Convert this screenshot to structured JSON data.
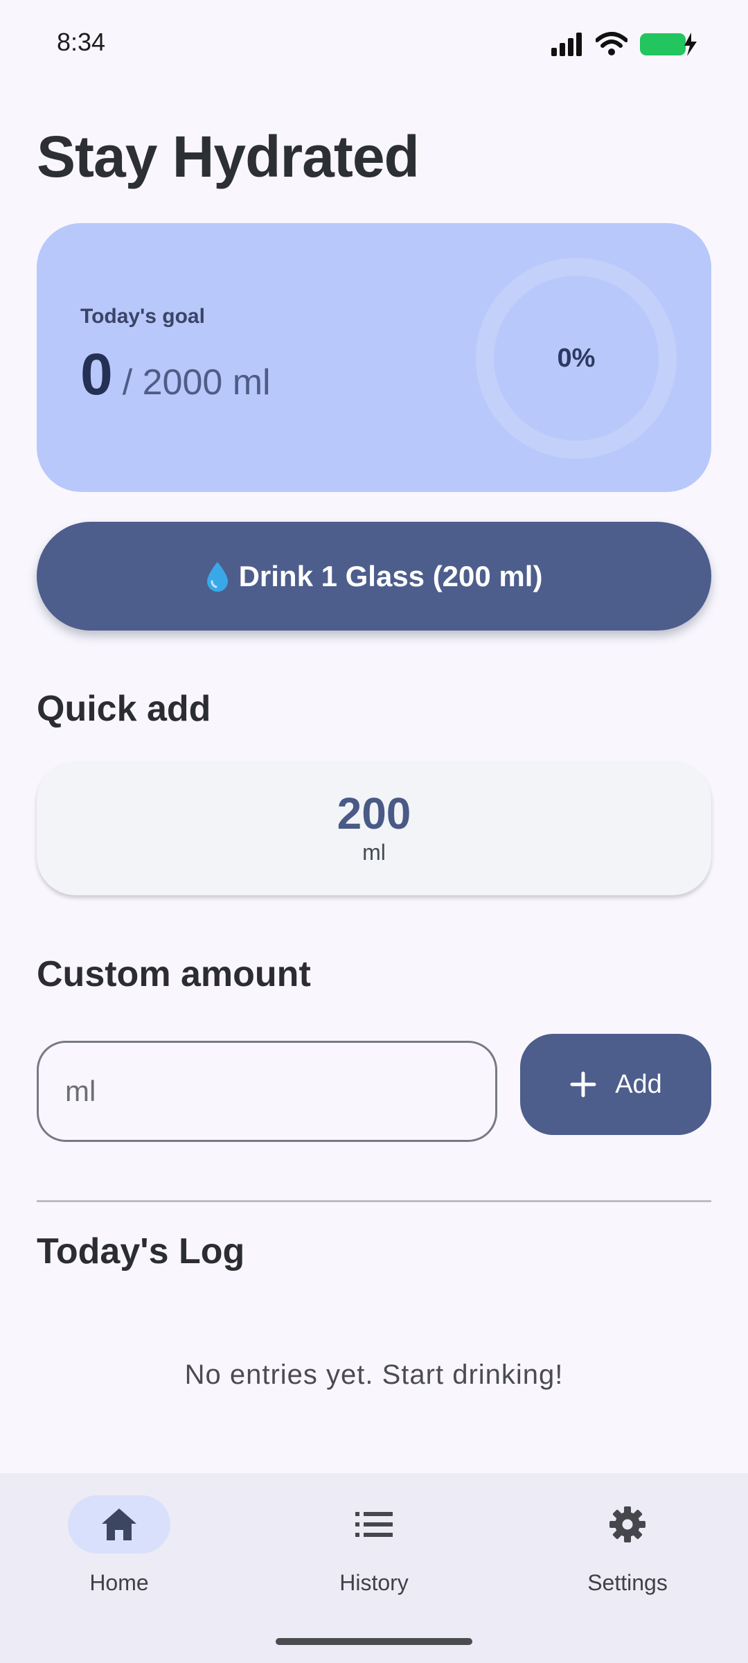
{
  "status_bar": {
    "time": "8:34"
  },
  "page": {
    "title": "Stay Hydrated"
  },
  "goal_card": {
    "label": "Today's goal",
    "current": "0",
    "total": "/ 2000 ml",
    "percent_text": "0%",
    "progress_fraction": 0
  },
  "drink_button": {
    "label": "Drink 1 Glass (200 ml)"
  },
  "quick_add": {
    "title": "Quick add",
    "value": "200",
    "unit": "ml"
  },
  "custom_amount": {
    "title": "Custom amount",
    "placeholder": "ml",
    "add_label": "Add"
  },
  "log": {
    "title": "Today's Log",
    "empty_message": "No entries yet. Start drinking!"
  },
  "bottom_nav": {
    "items": [
      {
        "label": "Home",
        "icon": "home-icon",
        "active": true
      },
      {
        "label": "History",
        "icon": "list-icon",
        "active": false
      },
      {
        "label": "Settings",
        "icon": "gear-icon",
        "active": false
      }
    ]
  },
  "colors": {
    "primary": "#4d5e8c",
    "goal_card_bg": "#b8c8fb",
    "background": "#f9f7fd",
    "battery": "#22c55e"
  }
}
